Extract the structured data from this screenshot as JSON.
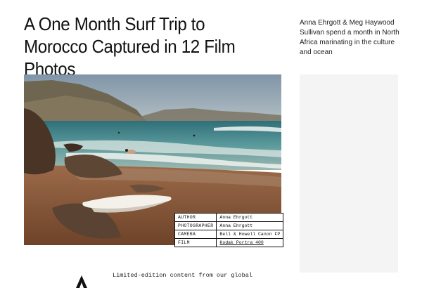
{
  "article": {
    "title": "A One Month Surf Trip to Morocco Captured in 12 Film Photos",
    "dek": "Anna Ehrgott & Meg Haywood Sullivan spend a month in North Africa marinating in the culture and ocean"
  },
  "credits": [
    {
      "label": "AUTHOR",
      "value": "Anna Ehrgott",
      "link": false
    },
    {
      "label": "PHOTOGRAPHER",
      "value": "Anna Ehrgott",
      "link": false
    },
    {
      "label": "CAMERA",
      "value": "Bell & Howell Canon FP",
      "link": false
    },
    {
      "label": "FILM",
      "value": "Kodak Portra 400",
      "link": true
    }
  ],
  "promo": {
    "text": "Limited-edition content from our global"
  },
  "icons": {
    "logo": "publication-logo-mark"
  },
  "colors": {
    "sky": "#8fa3b3",
    "sea": "#4a8a8e",
    "sand": "#8a5a3a",
    "sidebar_bg": "#f4f4f4"
  }
}
